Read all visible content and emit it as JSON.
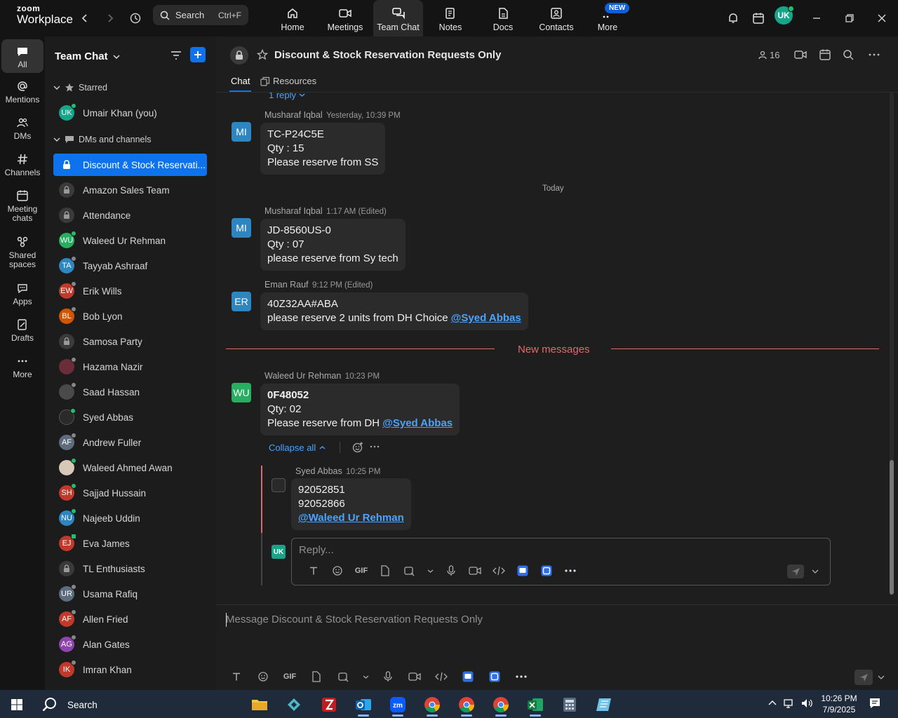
{
  "app": {
    "brand_top": "zoom",
    "brand_bottom": "Workplace"
  },
  "search": {
    "label": "Search",
    "shortcut": "Ctrl+F"
  },
  "nav": {
    "tabs": [
      {
        "label": "Home"
      },
      {
        "label": "Meetings"
      },
      {
        "label": "Team Chat"
      },
      {
        "label": "Notes"
      },
      {
        "label": "Docs"
      },
      {
        "label": "Contacts"
      },
      {
        "label": "More"
      }
    ],
    "new_badge": "NEW",
    "user_initials": "UK"
  },
  "rail": {
    "items": [
      {
        "label": "All"
      },
      {
        "label": "Mentions"
      },
      {
        "label": "DMs"
      },
      {
        "label": "Channels"
      },
      {
        "label": "Meeting chats"
      },
      {
        "label": "Shared spaces"
      },
      {
        "label": "Apps"
      },
      {
        "label": "Drafts"
      },
      {
        "label": "More"
      }
    ]
  },
  "sidebar": {
    "title": "Team Chat",
    "starred_label": "Starred",
    "starred_user": {
      "initials": "UK",
      "name": "Umair Khan (you)"
    },
    "dms_label": "DMs and channels",
    "items": [
      {
        "initials": "",
        "name": "Discount & Stock Reservati..."
      },
      {
        "initials": "",
        "name": "Amazon Sales Team"
      },
      {
        "initials": "",
        "name": "Attendance"
      },
      {
        "initials": "WU",
        "name": "Waleed Ur Rehman"
      },
      {
        "initials": "TA",
        "name": "Tayyab Ashraaf"
      },
      {
        "initials": "EW",
        "name": "Erik Wills"
      },
      {
        "initials": "BL",
        "name": "Bob Lyon"
      },
      {
        "initials": "",
        "name": "Samosa Party"
      },
      {
        "initials": "",
        "name": "Hazama Nazir"
      },
      {
        "initials": "",
        "name": "Saad Hassan"
      },
      {
        "initials": "",
        "name": "Syed Abbas"
      },
      {
        "initials": "AF",
        "name": "Andrew Fuller"
      },
      {
        "initials": "",
        "name": "Waleed Ahmed Awan"
      },
      {
        "initials": "SH",
        "name": "Sajjad Hussain"
      },
      {
        "initials": "NU",
        "name": "Najeeb Uddin"
      },
      {
        "initials": "EJ",
        "name": "Eva James"
      },
      {
        "initials": "",
        "name": "TL Enthusiasts"
      },
      {
        "initials": "UR",
        "name": "Usama Rafiq"
      },
      {
        "initials": "AF",
        "name": "Allen Fried"
      },
      {
        "initials": "AG",
        "name": "Alan Gates"
      },
      {
        "initials": "IK",
        "name": "Imran Khan"
      }
    ]
  },
  "channel": {
    "title": "Discount & Stock Reservation Requests Only",
    "member_count": "16",
    "tabs": {
      "chat": "Chat",
      "resources": "Resources"
    },
    "top_reply": "1 reply",
    "messages": [
      {
        "initials": "MI",
        "author": "Musharaf Iqbal",
        "time": "Yesterday, 10:39 PM",
        "lines": [
          "TC-P24C5E",
          "Qty : 15",
          "Please reserve from SS"
        ]
      },
      {
        "initials": "MI",
        "author": "Musharaf Iqbal",
        "time": "1:17 AM (Edited)",
        "lines": [
          "JD-8560US-0",
          "Qty : 07",
          "please reserve from Sy tech"
        ]
      },
      {
        "initials": "ER",
        "author": "Eman Rauf",
        "time": "9:12 PM (Edited)",
        "lines": [
          "40Z32AA#ABA",
          "please reserve 2 units from DH Choice "
        ],
        "mention": "@Syed Abbas"
      },
      {
        "initials": "WU",
        "author": "Waleed Ur Rehman",
        "time": "10:23 PM",
        "lines": [
          "0F48052",
          "Qty: 02",
          "Please reserve from DH "
        ],
        "mention": "@Syed Abbas"
      }
    ],
    "today_label": "Today",
    "new_messages_label": "New messages",
    "collapse_label": "Collapse all",
    "reply": {
      "author": "Syed Abbas",
      "time": "10:25 PM",
      "lines": [
        "92052851",
        "92052866"
      ],
      "mention": "@Waleed Ur Rehman"
    },
    "reply_placeholder": "Reply...",
    "reply_user_initials": "UK",
    "gif_label": "GIF",
    "composer_placeholder": "Message Discount & Stock Reservation Requests Only"
  },
  "taskbar": {
    "search_label": "Search",
    "time": "10:26 PM",
    "date": "7/9/2025"
  },
  "colors": {
    "accent": "#0e72ed",
    "new_messages": "#e06a6a",
    "mention": "#4aa3ff",
    "online": "#1fbf6f"
  }
}
